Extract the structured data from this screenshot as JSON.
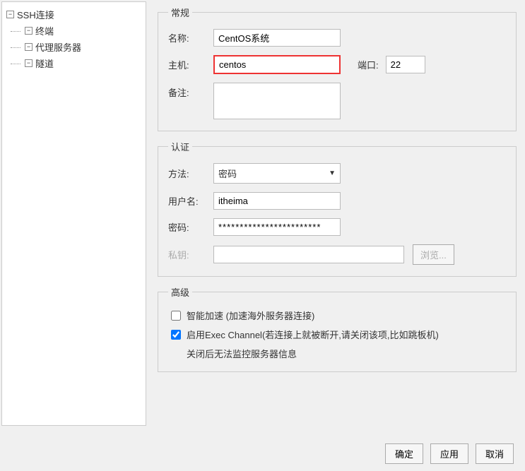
{
  "tree": {
    "root": "SSH连接",
    "children": [
      "终端",
      "代理服务器",
      "隧道"
    ]
  },
  "general": {
    "legend": "常规",
    "name_label": "名称:",
    "name_value": "CentOS系统",
    "host_label": "主机:",
    "host_value": "centos",
    "port_label": "端口:",
    "port_value": "22",
    "remark_label": "备注:",
    "remark_value": ""
  },
  "auth": {
    "legend": "认证",
    "method_label": "方法:",
    "method_value": "密码",
    "user_label": "用户名:",
    "user_value": "itheima",
    "pass_label": "密码:",
    "pass_value": "************************",
    "key_label": "私钥:",
    "key_value": "",
    "browse_label": "浏览..."
  },
  "advanced": {
    "legend": "高级",
    "smart_accel_label": "智能加速 (加速海外服务器连接)",
    "smart_accel_checked": false,
    "exec_channel_label": "启用Exec Channel(若连接上就被断开,请关闭该项,比如跳板机)",
    "exec_channel_checked": true,
    "exec_channel_sub": "关闭后无法监控服务器信息"
  },
  "buttons": {
    "ok": "确定",
    "apply": "应用",
    "cancel": "取消"
  },
  "toggle_minus": "−"
}
